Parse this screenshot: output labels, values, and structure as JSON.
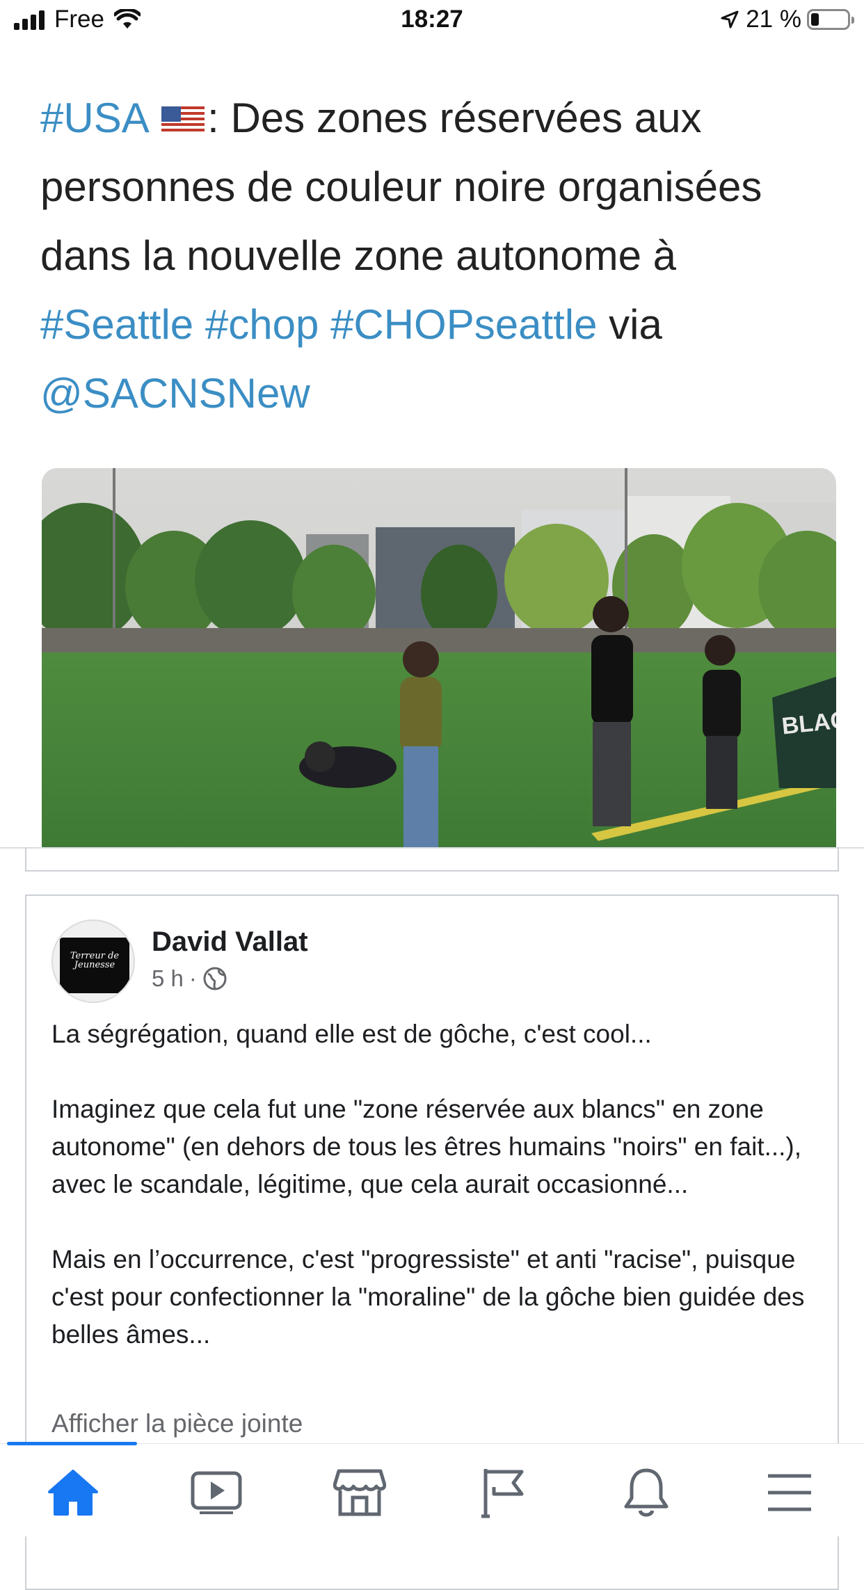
{
  "status_bar": {
    "carrier": "Free",
    "time": "18:27",
    "battery_label": "21 %",
    "battery_level": 0.21
  },
  "tweet": {
    "text_1": "#USA",
    "text_2": ": Des zones réservées aux personnes de couleur noire organisées dans la nouvelle zone autonome à ",
    "tag_seattle": "#Seattle",
    "tag_chop": "#chop",
    "tag_chopseattle": "#CHOPseattle",
    "text_via": " via ",
    "mention": "@SACNSNew",
    "image_banner_text": "BLACK"
  },
  "post": {
    "author": "David Vallat",
    "time": "5 h",
    "separator": "·",
    "avatar_text_1": "Terreur de",
    "avatar_text_2": "Jeunesse",
    "paragraphs": [
      "La ségrégation, quand elle est de gôche, c'est cool...",
      "Imaginez que cela fut une \"zone réservée aux blancs\" en zone autonome\" (en dehors de tous les êtres humains \"noirs\" en fait...), avec le scandale, légitime, que cela aurait occasionné...",
      "Mais en l’occurrence, c'est \"progressiste\" et anti \"racise\", puisque c'est pour confectionner la \"moraline\" de la gôche bien guidée des belles âmes..."
    ],
    "attachment_link": "Afficher la pièce jointe"
  },
  "nav": {
    "items": [
      "home-icon",
      "video-icon",
      "marketplace-icon",
      "pages-flag-icon",
      "notifications-bell-icon",
      "menu-icon"
    ],
    "accent": "#1877f2",
    "inactive": "#606770"
  }
}
